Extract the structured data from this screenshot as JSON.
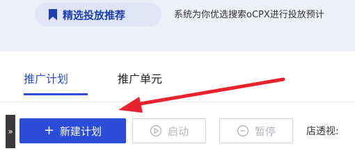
{
  "recommend": {
    "pill_label": "精选投放推荐",
    "description": "系统为你优选搜索oCPX进行投放预计"
  },
  "tabs": [
    {
      "label": "推广计划",
      "active": true
    },
    {
      "label": "推广单元",
      "active": false
    }
  ],
  "side_toggle": {
    "glyph": "»"
  },
  "toolbar": {
    "new_plan_icon": "+",
    "new_plan_label": "新建计划",
    "start_label": "启动",
    "pause_label": "暂停",
    "shop_label": "店透视:"
  },
  "colors": {
    "accent": "#2a4bd7",
    "annotation_arrow": "#e8232e",
    "disabled": "#b2b6bf"
  }
}
